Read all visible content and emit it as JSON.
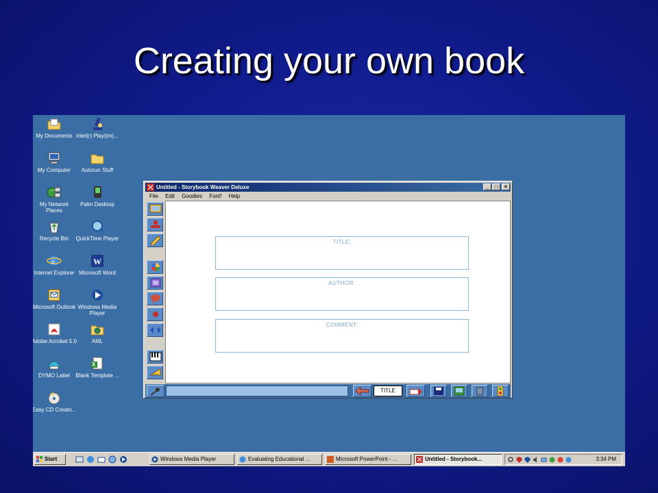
{
  "slide": {
    "title": "Creating your own book"
  },
  "desktop": {
    "icons": [
      {
        "id": "my-documents",
        "label": "My Documents",
        "icon": "folder-document-icon"
      },
      {
        "id": "intel-play",
        "label": "Intel(r) Play(tm)...",
        "icon": "microscope-shortcut-icon"
      },
      {
        "id": "my-computer",
        "label": "My Computer",
        "icon": "computer-icon"
      },
      {
        "id": "autorun-stuff",
        "label": "Autorun Stuff",
        "icon": "folder-icon"
      },
      {
        "id": "my-network-places",
        "label": "My Network Places",
        "icon": "network-icon"
      },
      {
        "id": "palm-desktop",
        "label": "Palm Desktop",
        "icon": "palm-shortcut-icon"
      },
      {
        "id": "recycle-bin",
        "label": "Recycle Bin",
        "icon": "recycle-bin-icon"
      },
      {
        "id": "quicktime-player",
        "label": "QuickTime Player",
        "icon": "quicktime-icon"
      },
      {
        "id": "internet-explorer",
        "label": "Internet Explorer",
        "icon": "internet-explorer-icon"
      },
      {
        "id": "microsoft-word",
        "label": "Microsoft Word",
        "icon": "word-icon"
      },
      {
        "id": "microsoft-outlook",
        "label": "Microsoft Outlook",
        "icon": "outlook-icon"
      },
      {
        "id": "windows-media-player",
        "label": "Windows Media Player",
        "icon": "media-player-icon"
      },
      {
        "id": "adobe-acrobat",
        "label": "Adobe Acrobat 5.0",
        "icon": "acrobat-icon"
      },
      {
        "id": "aml",
        "label": "AML",
        "icon": "folder-globe-icon"
      },
      {
        "id": "dymo-label",
        "label": "DYMO Label",
        "icon": "dymo-label-icon"
      },
      {
        "id": "blank-template",
        "label": "Blank Template ...",
        "icon": "excel-doc-icon"
      },
      {
        "id": "easy-cd-creator",
        "label": "Easy CD Creato...",
        "icon": "cd-creator-icon"
      }
    ]
  },
  "app": {
    "title": "Untitled - Storybook Weaver Deluxe",
    "menu": [
      "File",
      "Edit",
      "Goodies",
      "Font!",
      "Help"
    ],
    "fields": [
      {
        "label": "TITLE:"
      },
      {
        "label": "AUTHOR:"
      },
      {
        "label": "COMMENT:"
      }
    ],
    "text_input": {
      "value": ""
    },
    "page_selector": "TITLE"
  },
  "taskbar": {
    "start_label": "Start",
    "tasks": [
      {
        "label": "Windows Media Player",
        "active": false
      },
      {
        "label": "Evaluating Educational ...",
        "active": false
      },
      {
        "label": "Microsoft PowerPoint - ...",
        "active": false
      },
      {
        "label": "Untitled - Storybook...",
        "active": true
      }
    ],
    "clock": "3:34 PM"
  },
  "colors": {
    "slide_bg": "#101b8c",
    "desktop_bg": "#3a6ea5",
    "toolbar_button": "#5a8bc6",
    "field_border": "#8fb6d6"
  }
}
